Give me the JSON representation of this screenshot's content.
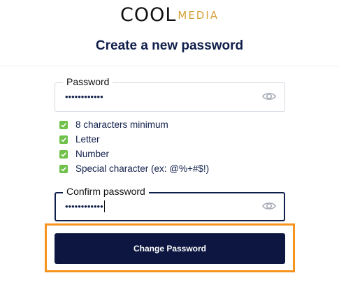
{
  "brand": {
    "logo_primary": "COOL",
    "logo_secondary": "MEDIA",
    "logo_secondary_color": "#d6a33a"
  },
  "header": {
    "title": "Create a new password"
  },
  "password_field": {
    "label": "Password",
    "value": "••••••••••••",
    "icon": "eye-icon"
  },
  "requirements": {
    "check_color": "#6fc14a",
    "items": [
      {
        "label": "8 characters minimum",
        "met": true
      },
      {
        "label": "Letter",
        "met": true
      },
      {
        "label": "Number",
        "met": true
      },
      {
        "label": "Special character (ex: @%+#$!)",
        "met": true
      }
    ]
  },
  "confirm_field": {
    "label": "Confirm password",
    "value": "••••••••••••",
    "icon": "eye-icon",
    "focused": true
  },
  "submit": {
    "label": "Change Password",
    "color": "#0c1640",
    "highlight_color": "#f7941d"
  }
}
